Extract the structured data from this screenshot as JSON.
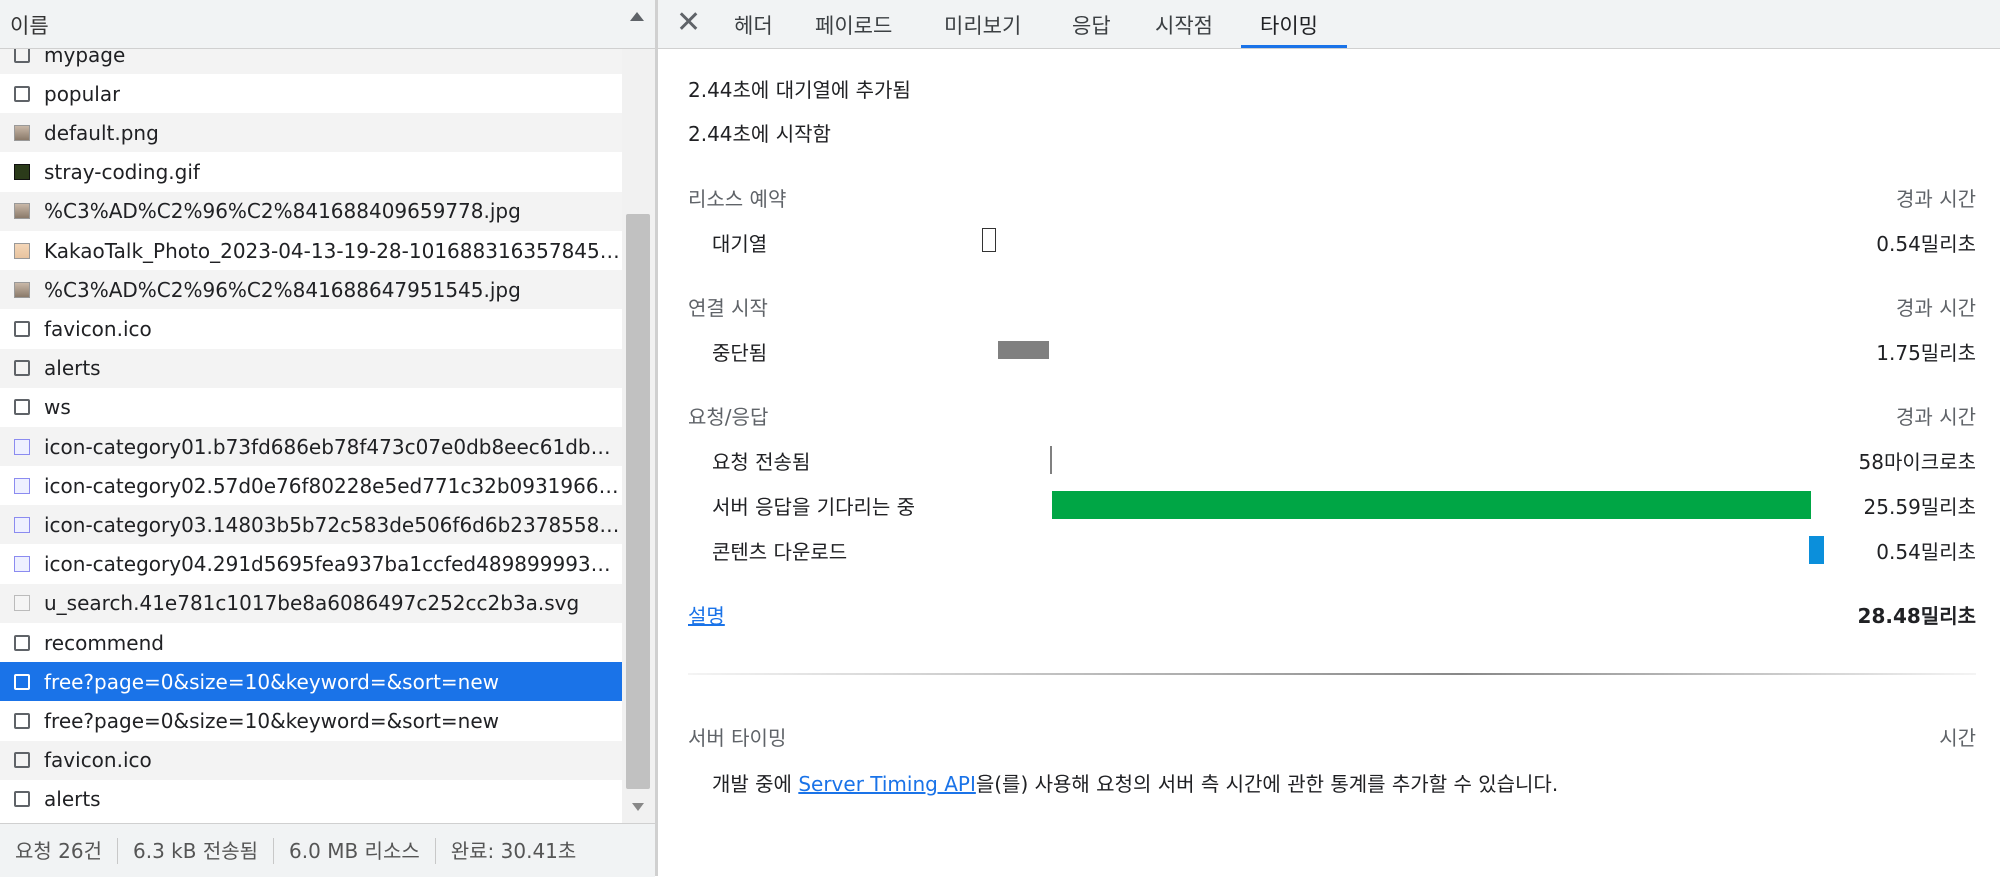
{
  "left": {
    "column_header": "이름",
    "items": [
      {
        "name": "mypage",
        "icon": "document-icon"
      },
      {
        "name": "popular",
        "icon": "document-icon"
      },
      {
        "name": "default.png",
        "icon": "image-icon"
      },
      {
        "name": "stray-coding.gif",
        "icon": "gif-icon"
      },
      {
        "name": "%C3%AD%C2%96%C2%841688409659778.jpg",
        "icon": "image-icon"
      },
      {
        "name": "KakaoTalk_Photo_2023-04-13-19-28-101688316357845....",
        "icon": "photo-icon"
      },
      {
        "name": "%C3%AD%C2%96%C2%841688647951545.jpg",
        "icon": "image-icon"
      },
      {
        "name": "favicon.ico",
        "icon": "document-icon"
      },
      {
        "name": "alerts",
        "icon": "document-icon"
      },
      {
        "name": "ws",
        "icon": "document-icon"
      },
      {
        "name": "icon-category01.b73fd686eb78f473c07e0db8eec61db3....",
        "icon": "svg-icon"
      },
      {
        "name": "icon-category02.57d0e76f80228e5ed771c32b0931966d....",
        "icon": "svg-icon"
      },
      {
        "name": "icon-category03.14803b5b72c583de506f6d6b2378558d....",
        "icon": "svg-icon"
      },
      {
        "name": "icon-category04.291d5695fea937ba1ccfed4898999933.s...",
        "icon": "svg-icon"
      },
      {
        "name": "u_search.41e781c1017be8a6086497c252cc2b3a.svg",
        "icon": "svg-gray-icon"
      },
      {
        "name": "recommend",
        "icon": "document-icon"
      },
      {
        "name": "free?page=0&size=10&keyword=&sort=new",
        "icon": "document-icon",
        "selected": true
      },
      {
        "name": "free?page=0&size=10&keyword=&sort=new",
        "icon": "document-icon"
      },
      {
        "name": "favicon.ico",
        "icon": "document-icon"
      },
      {
        "name": "alerts",
        "icon": "document-icon"
      }
    ],
    "status": {
      "requests": "요청 26건",
      "transferred": "6.3 kB 전송됨",
      "resources": "6.0 MB 리소스",
      "finish": "완료: 30.41초"
    }
  },
  "tabs": {
    "items": [
      "헤더",
      "페이로드",
      "미리보기",
      "응답",
      "시작점",
      "타이밍"
    ],
    "active": "타이밍"
  },
  "timing": {
    "queued_at": "2.44초에 대기열에 추가됨",
    "started_at": "2.44초에 시작함",
    "resource_scheduling": {
      "title": "리소스 예약",
      "elapsed_label": "경과 시간",
      "rows": [
        {
          "label": "대기열",
          "value": "0.54밀리초"
        }
      ]
    },
    "connection_start": {
      "title": "연결 시작",
      "elapsed_label": "경과 시간",
      "rows": [
        {
          "label": "중단됨",
          "value": "1.75밀리초"
        }
      ]
    },
    "request_response": {
      "title": "요청/응답",
      "elapsed_label": "경과 시간",
      "rows": [
        {
          "label": "요청 전송됨",
          "value": "58마이크로초"
        },
        {
          "label": "서버 응답을 기다리는 중",
          "value": "25.59밀리초"
        },
        {
          "label": "콘텐츠 다운로드",
          "value": "0.54밀리초"
        }
      ]
    },
    "explanation_link": "설명",
    "total": "28.48밀리초",
    "server_timing": {
      "title": "서버 타이밍",
      "time_label": "시간",
      "text_before": "개발 중에 ",
      "link": "Server Timing API",
      "text_after": "을(를) 사용해 요청의 서버 측 시간에 관한 통계를 추가할 수 있습니다."
    },
    "colors": {
      "queue": "#ffffff",
      "stalled": "#808080",
      "sent": "#808080",
      "waiting": "#00a645",
      "download": "#0b8fdb"
    }
  }
}
